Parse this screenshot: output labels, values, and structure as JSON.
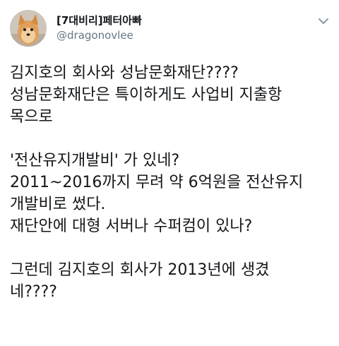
{
  "author": {
    "display_name": "[7대비리]페터아빠",
    "handle": "@dragonovlee",
    "avatar_icon": "dog-avatar-icon"
  },
  "menu": {
    "icon": "chevron-down-icon"
  },
  "tweet": {
    "lines": [
      "김지호의 회사와 성남문화재단????",
      "성남문화재단은 특이하게도 사업비 지출항",
      "목으로",
      "",
      "'전산유지개발비' 가 있네?",
      "2011~2016까지 무려 약 6억원을 전산유지",
      "개발비로 썼다.",
      "재단안에 대형 서버나 수퍼컴이 있나?",
      "",
      "그런데 김지호의 회사가 2013년에 생겼",
      "네????"
    ]
  },
  "colors": {
    "text": "#14171a",
    "secondary": "#657786"
  }
}
